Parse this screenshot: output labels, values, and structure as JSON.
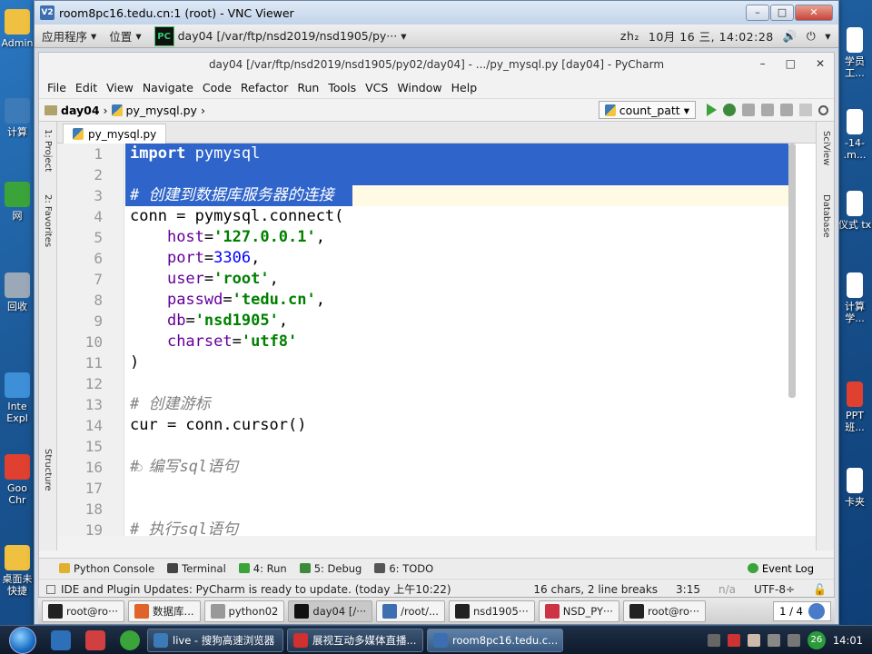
{
  "desktop": {
    "left_icons": [
      "Admin",
      "计算",
      "网",
      "回收",
      "Inte Expl",
      "Goo Chr",
      "桌面未 快捷"
    ],
    "right_icons": [
      "学员 工...",
      "-14- .m...",
      "仪式 tx",
      "计算 学...",
      "PPT 班...",
      "卡夹"
    ]
  },
  "vnc": {
    "title": "room8pc16.tedu.cn:1 (root) - VNC Viewer",
    "icon": "V2"
  },
  "gnome_panel": {
    "apps_menu": "应用程序",
    "places_menu": "位置",
    "window_title": "day04 [/var/ftp/nsd2019/nsd1905/py···",
    "input_method": "zh₂",
    "clock": "10月 16 三, 14:02:28"
  },
  "pycharm": {
    "title": "day04 [/var/ftp/nsd2019/nsd1905/py02/day04] - .../py_mysql.py [day04] - PyCharm",
    "menu": [
      "File",
      "Edit",
      "View",
      "Navigate",
      "Code",
      "Refactor",
      "Run",
      "Tools",
      "VCS",
      "Window",
      "Help"
    ],
    "breadcrumb": {
      "project": "day04",
      "file": "py_mysql.py"
    },
    "run_config": "count_patt",
    "tab": "py_mysql.py",
    "left_stripe": [
      "1: Project",
      "2: Favorites",
      "Structure"
    ],
    "right_stripe": [
      "SciView",
      "Database"
    ],
    "lines": [
      {
        "n": "1",
        "tokens": [
          {
            "t": "import",
            "c": "kw"
          },
          {
            "t": " pymysql",
            "c": ""
          }
        ],
        "selected": true
      },
      {
        "n": "2",
        "tokens": [],
        "selected": true
      },
      {
        "n": "3",
        "tokens": [
          {
            "t": "# 创建到数据库服务器的连接",
            "c": "cm"
          }
        ],
        "selected": true,
        "caret": true
      },
      {
        "n": "4",
        "tokens": [
          {
            "t": "conn = pymysql.connect(",
            "c": ""
          }
        ]
      },
      {
        "n": "5",
        "tokens": [
          {
            "t": "    ",
            "c": ""
          },
          {
            "t": "host",
            "c": "kwarg"
          },
          {
            "t": "=",
            "c": ""
          },
          {
            "t": "'127.0.0.1'",
            "c": "str"
          },
          {
            "t": ",",
            "c": ""
          }
        ]
      },
      {
        "n": "6",
        "tokens": [
          {
            "t": "    ",
            "c": ""
          },
          {
            "t": "port",
            "c": "kwarg"
          },
          {
            "t": "=",
            "c": ""
          },
          {
            "t": "3306",
            "c": "num"
          },
          {
            "t": ",",
            "c": ""
          }
        ]
      },
      {
        "n": "7",
        "tokens": [
          {
            "t": "    ",
            "c": ""
          },
          {
            "t": "user",
            "c": "kwarg"
          },
          {
            "t": "=",
            "c": ""
          },
          {
            "t": "'root'",
            "c": "str"
          },
          {
            "t": ",",
            "c": ""
          }
        ]
      },
      {
        "n": "8",
        "tokens": [
          {
            "t": "    ",
            "c": ""
          },
          {
            "t": "passwd",
            "c": "kwarg"
          },
          {
            "t": "=",
            "c": ""
          },
          {
            "t": "'tedu.cn'",
            "c": "str"
          },
          {
            "t": ",",
            "c": ""
          }
        ]
      },
      {
        "n": "9",
        "tokens": [
          {
            "t": "    ",
            "c": ""
          },
          {
            "t": "db",
            "c": "kwarg"
          },
          {
            "t": "=",
            "c": ""
          },
          {
            "t": "'nsd1905'",
            "c": "str"
          },
          {
            "t": ",",
            "c": ""
          }
        ]
      },
      {
        "n": "10",
        "tokens": [
          {
            "t": "    ",
            "c": ""
          },
          {
            "t": "charset",
            "c": "kwarg"
          },
          {
            "t": "=",
            "c": ""
          },
          {
            "t": "'utf8'",
            "c": "str"
          }
        ]
      },
      {
        "n": "11",
        "tokens": [
          {
            "t": ")",
            "c": ""
          }
        ]
      },
      {
        "n": "12",
        "tokens": []
      },
      {
        "n": "13",
        "tokens": [
          {
            "t": "# 创建游标",
            "c": "cm"
          }
        ]
      },
      {
        "n": "14",
        "tokens": [
          {
            "t": "cur = conn.cursor()",
            "c": ""
          }
        ]
      },
      {
        "n": "15",
        "tokens": []
      },
      {
        "n": "16",
        "tokens": [
          {
            "t": "# 编写sql语句",
            "c": "cm"
          }
        ]
      },
      {
        "n": "17",
        "tokens": []
      },
      {
        "n": "18",
        "tokens": []
      },
      {
        "n": "19",
        "tokens": [
          {
            "t": "# 执行sql语句",
            "c": "cm"
          }
        ]
      }
    ],
    "tool_windows": [
      {
        "label": "Python Console",
        "color": "#e0b030"
      },
      {
        "label": "Terminal",
        "color": "#444444"
      },
      {
        "label": "4: Run",
        "color": "#3aa33a"
      },
      {
        "label": "5: Debug",
        "color": "#3d8a3d"
      },
      {
        "label": "6: TODO",
        "color": "#555555"
      }
    ],
    "event_log": "Event Log",
    "status": {
      "message": "IDE and Plugin Updates: PyCharm is ready to update. (today 上午10:22)",
      "selection": "16 chars, 2 line breaks",
      "position": "3:15",
      "line_sep": "n/a",
      "encoding": "UTF-8÷"
    }
  },
  "gnome_taskbar": {
    "items": [
      {
        "label": "root@ro···",
        "color": "#222222"
      },
      {
        "label": "数据库...",
        "color": "#e0642a"
      },
      {
        "label": "python02",
        "color": "#999999"
      },
      {
        "label": "day04 [/···",
        "color": "#111111",
        "active": true
      },
      {
        "label": "/root/...",
        "color": "#3d6fb0"
      },
      {
        "label": "nsd1905···",
        "color": "#222222"
      },
      {
        "label": "NSD_PY···",
        "color": "#cc3344"
      },
      {
        "label": "root@ro···",
        "color": "#222222"
      }
    ],
    "pager": "1 / 4"
  },
  "win_taskbar": {
    "items": [
      {
        "label": "live - 搜狗高速浏览器",
        "color": "#3d7ab8"
      },
      {
        "label": "展视互动多媒体直播...",
        "color": "#d03030"
      },
      {
        "label": "room8pc16.tedu.c...",
        "color": "#3d6fb0",
        "active": true
      }
    ],
    "badge": "26",
    "clock": "14:01"
  }
}
